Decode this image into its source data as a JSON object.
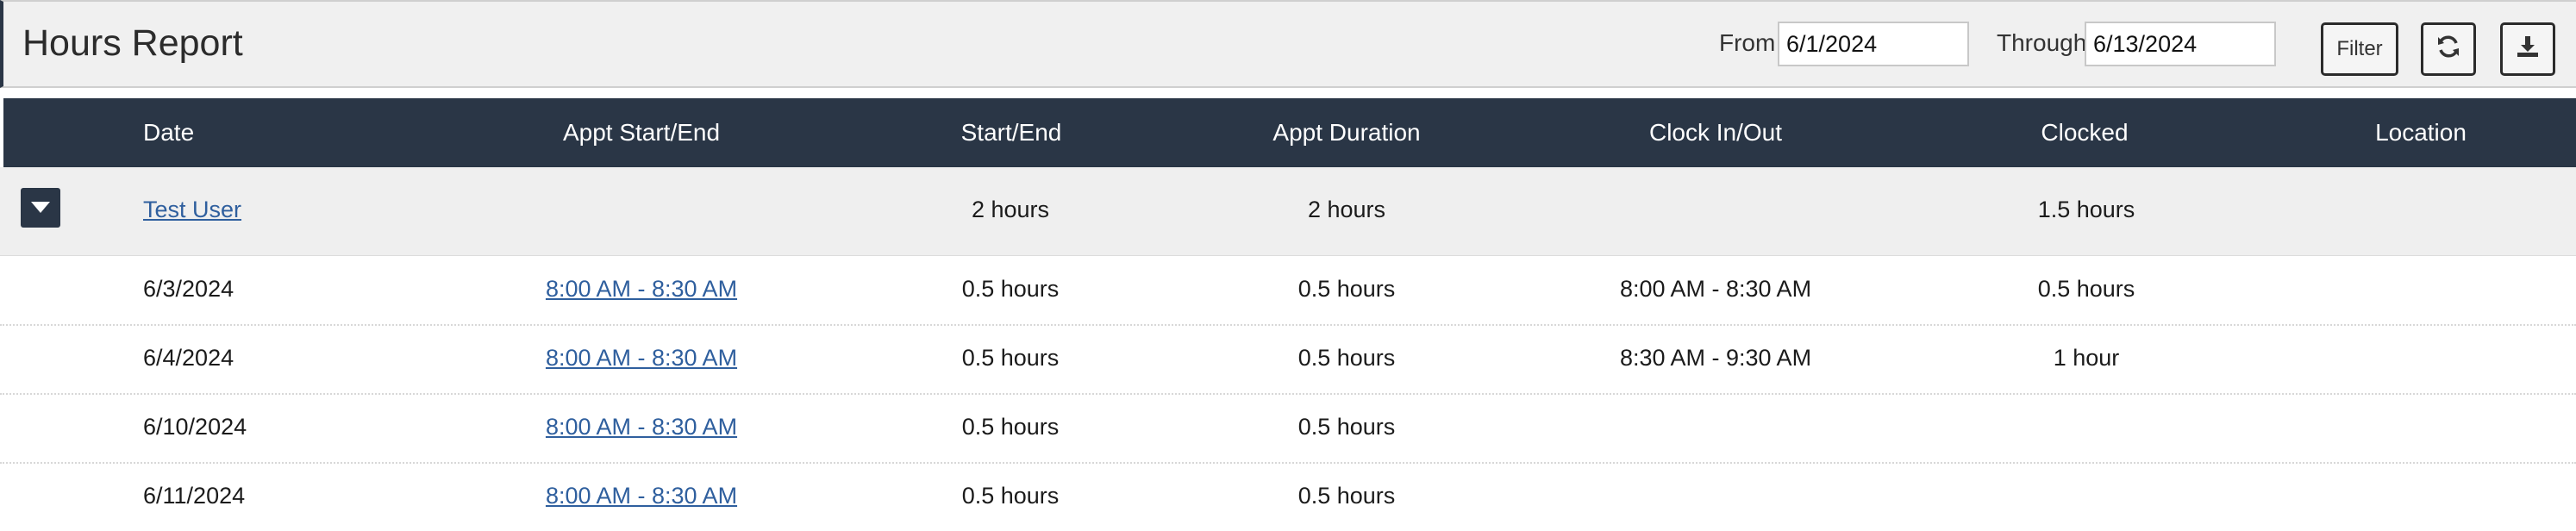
{
  "header": {
    "title": "Hours Report",
    "from_label": "From",
    "from_value": "6/1/2024",
    "through_label": "Through",
    "through_value": "6/13/2024",
    "filter_label": "Filter",
    "refresh_icon": "refresh-icon",
    "download_icon": "download-icon"
  },
  "table": {
    "columns": [
      "Date",
      "Appt Start/End",
      "Start/End",
      "Appt Duration",
      "Clock In/Out",
      "Clocked",
      "Location"
    ],
    "group": {
      "name": "Test User",
      "start_end": "2 hours",
      "appt_duration": "2 hours",
      "clocked": "1.5 hours"
    },
    "rows": [
      {
        "date": "6/3/2024",
        "appt": "8:00 AM - 8:30 AM",
        "start_end": "0.5 hours",
        "appt_duration": "0.5 hours",
        "clock": "8:00 AM - 8:30 AM",
        "clocked": "0.5 hours",
        "location": ""
      },
      {
        "date": "6/4/2024",
        "appt": "8:00 AM - 8:30 AM",
        "start_end": "0.5 hours",
        "appt_duration": "0.5 hours",
        "clock": "8:30 AM - 9:30 AM",
        "clocked": "1 hour",
        "location": ""
      },
      {
        "date": "6/10/2024",
        "appt": "8:00 AM - 8:30 AM",
        "start_end": "0.5 hours",
        "appt_duration": "0.5 hours",
        "clock": "",
        "clocked": "",
        "location": ""
      },
      {
        "date": "6/11/2024",
        "appt": "8:00 AM - 8:30 AM",
        "start_end": "0.5 hours",
        "appt_duration": "0.5 hours",
        "clock": "",
        "clocked": "",
        "location": ""
      }
    ]
  },
  "colors": {
    "header_dark": "#2a3646",
    "link": "#2f5f9e",
    "toolbar_bg": "#f0f0f0"
  }
}
